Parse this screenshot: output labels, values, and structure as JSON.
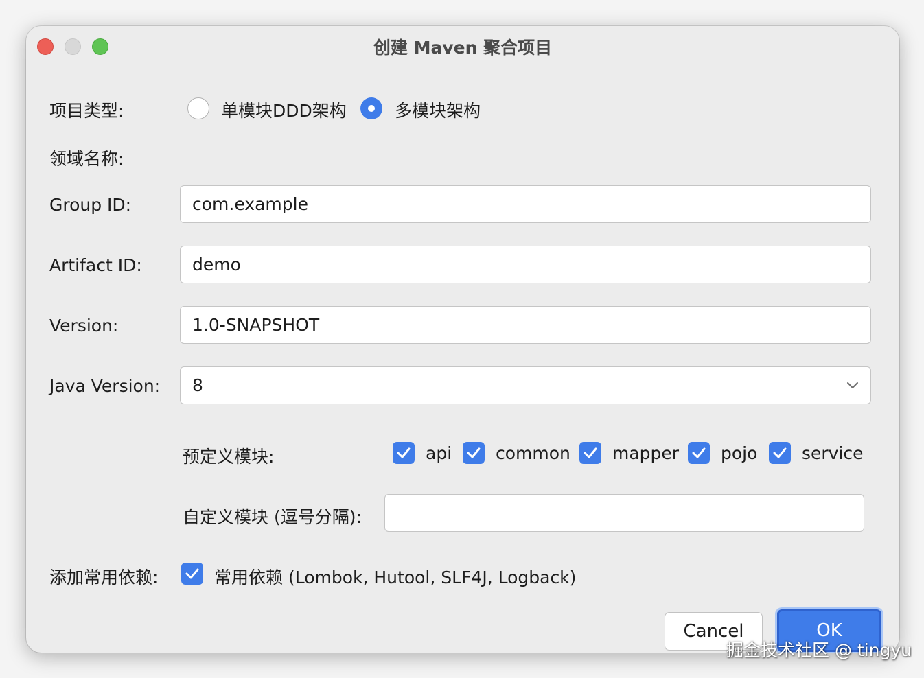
{
  "window": {
    "title": "创建 Maven 聚合项目"
  },
  "project_type": {
    "label": "项目类型:",
    "options": [
      {
        "label": "单模块DDD架构",
        "selected": false
      },
      {
        "label": "多模块架构",
        "selected": true
      }
    ]
  },
  "domain_name": {
    "label": "领域名称:"
  },
  "group_id": {
    "label": "Group ID:",
    "value": "com.example"
  },
  "artifact_id": {
    "label": "Artifact ID:",
    "value": "demo"
  },
  "version": {
    "label": "Version:",
    "value": "1.0-SNAPSHOT"
  },
  "java_version": {
    "label": "Java Version:",
    "value": "8"
  },
  "predefined_modules": {
    "label": "预定义模块:",
    "items": [
      {
        "label": "api",
        "checked": true
      },
      {
        "label": "common",
        "checked": true
      },
      {
        "label": "mapper",
        "checked": true
      },
      {
        "label": "pojo",
        "checked": true
      },
      {
        "label": "service",
        "checked": true
      }
    ]
  },
  "custom_modules": {
    "label": "自定义模块 (逗号分隔):",
    "value": ""
  },
  "dependencies": {
    "label": "添加常用依赖:",
    "checkbox_label": "常用依赖 (Lombok, Hutool, SLF4J, Logback)",
    "checked": true
  },
  "buttons": {
    "cancel": "Cancel",
    "ok": "OK"
  },
  "watermark": "掘金技术社区 @ tingyu",
  "colors": {
    "accent": "#3f7ce9",
    "window_bg": "#ececec",
    "close": "#ed5f57",
    "minimize": "#d8d8d8",
    "maximize": "#5fc454"
  }
}
